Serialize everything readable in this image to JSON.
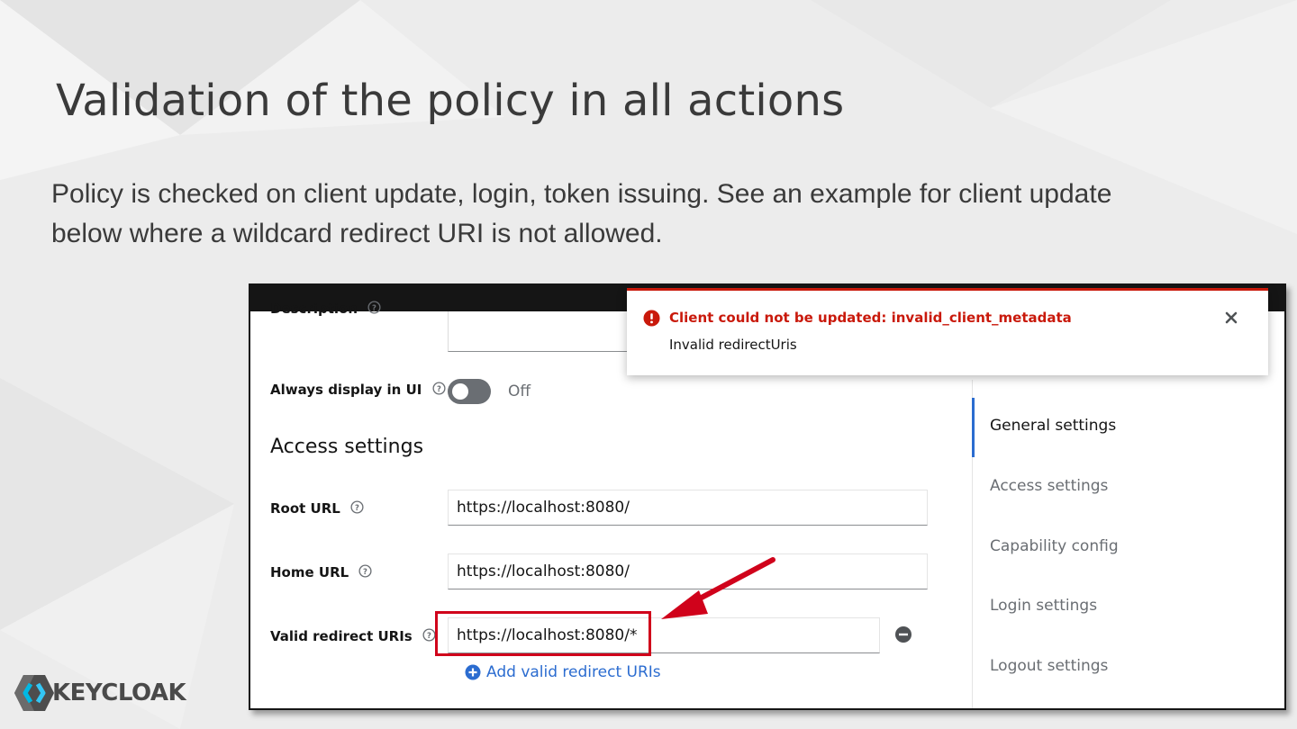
{
  "slide": {
    "title": "Validation of the policy in all actions",
    "subtitle": "Policy is checked on client update, login, token issuing. See an example for client update below where a wildcard redirect URI is not allowed."
  },
  "form": {
    "description_label": "Description",
    "always_display_label": "Always display in UI",
    "always_display_state": "Off",
    "always_display_on": false,
    "section_heading": "Access settings",
    "root_url_label": "Root URL",
    "root_url_value": "https://localhost:8080/",
    "home_url_label": "Home URL",
    "home_url_value": "https://localhost:8080/",
    "redirect_label": "Valid redirect URIs",
    "redirect_value": "https://localhost:8080/*",
    "add_redirect_label": "Add valid redirect URIs"
  },
  "jump_links": [
    {
      "label": "General settings",
      "active": true
    },
    {
      "label": "Access settings",
      "active": false
    },
    {
      "label": "Capability config",
      "active": false
    },
    {
      "label": "Login settings",
      "active": false
    },
    {
      "label": "Logout settings",
      "active": false
    }
  ],
  "alert": {
    "title": "Client could not be updated: invalid_client_metadata",
    "description": "Invalid redirectUris"
  },
  "logo": {
    "text": "KEYCLOAK"
  },
  "colors": {
    "danger": "#c9190b",
    "link": "#2b6cd0",
    "highlight": "#d0021b",
    "masthead": "#151515"
  },
  "icons": {
    "help": "help-icon",
    "alert": "exclamation-circle-icon",
    "close": "close-icon",
    "remove": "minus-circle-icon",
    "add": "plus-circle-icon"
  }
}
